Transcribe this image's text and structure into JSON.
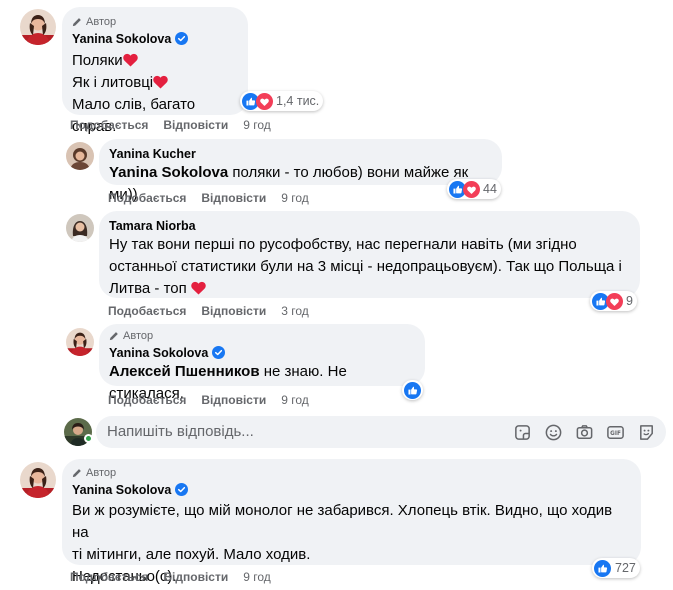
{
  "colors": {
    "accent": "#1877f2",
    "heart": "#f33e58",
    "bubble": "#f0f2f5",
    "secondary_text": "#65676b"
  },
  "actions": {
    "like": "Подобається",
    "reply": "Відповісти"
  },
  "comments": [
    {
      "author_badge": "Автор",
      "name": "Yanina Sokolova",
      "verified": true,
      "lines": [
        "Поляки",
        "Як і литовці",
        "Мало слів, багато справ."
      ],
      "reactions_count": "1,4 тис.",
      "reaction_icons": [
        "like-icon",
        "heart-icon"
      ],
      "time": "9 год"
    },
    {
      "name": "Yanina Kucher",
      "mention": "Yanina Sokolova",
      "text": " поляки - то любов) вони майже як ми))",
      "reactions_count": "44",
      "reaction_icons": [
        "like-icon",
        "heart-icon"
      ],
      "time": "9 год"
    },
    {
      "name": "Tamara Niorba",
      "lines": [
        "Ну так вони перші по русофобству, нас перегнали навіть (ми згідно",
        "останньої статистики були на 3 місці - недопрацьовуєм). Так що Польща і",
        "Литва - топ"
      ],
      "reactions_count": "9",
      "reaction_icons": [
        "like-icon",
        "heart-icon"
      ],
      "time": "3 год"
    },
    {
      "author_badge": "Автор",
      "name": "Yanina Sokolova",
      "verified": true,
      "mention": "Алексей Пшенников",
      "text": " не знаю. Не стикалася.",
      "reaction_icons": [
        "like-icon"
      ],
      "time": "9 год"
    },
    {
      "author_badge": "Автор",
      "name": "Yanina Sokolova",
      "verified": true,
      "lines": [
        "Ви ж розумієте, що мій монолог не забарився. Хлопець втік. Видно, що ходив на",
        "ті мітинги, але похуй. Мало ходив.",
        "Недостаньо(с)."
      ],
      "reactions_count": "727",
      "reaction_icons": [
        "like-icon"
      ],
      "time": "9 год"
    }
  ],
  "reply_box": {
    "placeholder": "Напишіть відповідь...",
    "tools": [
      "sticker-icon",
      "emoji-icon",
      "camera-icon",
      "gif-icon",
      "sticker-face-icon"
    ]
  }
}
